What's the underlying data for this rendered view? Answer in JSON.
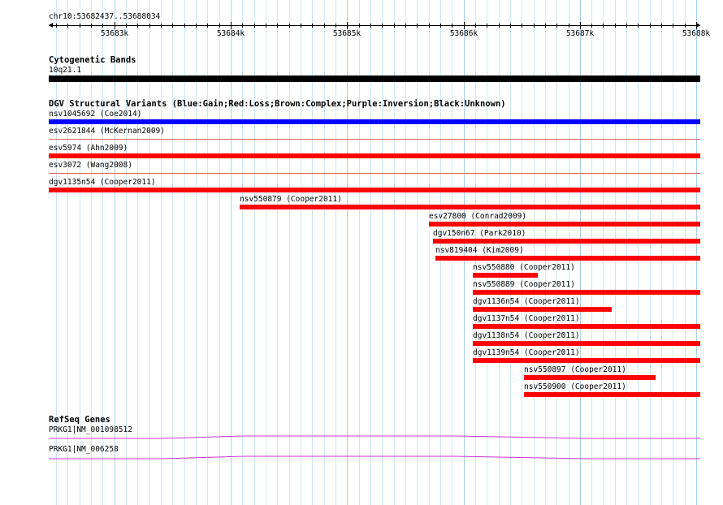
{
  "ruler": {
    "coordinate_label": "chr10:53682437..53688034",
    "ticks": [
      "53683k",
      "53684k",
      "53685k",
      "53686k",
      "53687k",
      "53688k"
    ]
  },
  "cytoband": {
    "title": "Cytogenetic Bands",
    "band_label": "10q21.1",
    "color": "#000000"
  },
  "dgv": {
    "title": "DGV Structural Variants (Blue:Gain;Red:Loss;Brown:Complex;Purple:Inversion;Black:Unknown)",
    "colors": {
      "gain": "#0000ff",
      "loss": "#ff0000",
      "separator": "#e06060"
    },
    "variants": [
      {
        "label": "nsv1045692 (Coe2014)",
        "type": "gain",
        "start": 53682437,
        "end": 53688034
      },
      {
        "label": "esv2621844 (McKernan2009)",
        "type": "loss",
        "start": null,
        "end": null
      },
      {
        "label": "esv5974 (Ahn2009)",
        "type": "loss",
        "start": 53682437,
        "end": 53688034
      },
      {
        "label": "esv3072 (Wang2008)",
        "type": "loss",
        "start": null,
        "end": null
      },
      {
        "label": "dgv1135n54 (Cooper2011)",
        "type": "loss",
        "start": 53682437,
        "end": 53688034
      },
      {
        "label": "nsv550879 (Cooper2011)",
        "type": "loss",
        "start": 53684080,
        "end": 53688034
      },
      {
        "label": "esv27800 (Conrad2009)",
        "type": "loss",
        "start": 53685700,
        "end": 53688034
      },
      {
        "label": "dgv150n67 (Park2010)",
        "type": "loss",
        "start": 53685740,
        "end": 53688034
      },
      {
        "label": "nsv819404 (Kim2009)",
        "type": "loss",
        "start": 53685760,
        "end": 53688034
      },
      {
        "label": "nsv550880 (Cooper2011)",
        "type": "loss",
        "start": 53686080,
        "end": 53686640
      },
      {
        "label": "nsv550889 (Cooper2011)",
        "type": "loss",
        "start": 53686080,
        "end": 53688034
      },
      {
        "label": "dgv1136n54 (Cooper2011)",
        "type": "loss",
        "start": 53686080,
        "end": 53687270
      },
      {
        "label": "dgv1137n54 (Cooper2011)",
        "type": "loss",
        "start": 53686080,
        "end": 53688034
      },
      {
        "label": "dgv1138n54 (Cooper2011)",
        "type": "loss",
        "start": 53686080,
        "end": 53688034
      },
      {
        "label": "dgv1139n54 (Cooper2011)",
        "type": "loss",
        "start": 53686080,
        "end": 53688034
      },
      {
        "label": "nsv550897 (Cooper2011)",
        "type": "loss",
        "start": 53686520,
        "end": 53687650
      },
      {
        "label": "nsv550900 (Cooper2011)",
        "type": "loss",
        "start": 53686520,
        "end": 53688034
      }
    ]
  },
  "refseq": {
    "title": "RefSeq Genes",
    "color": "#cc33cc",
    "genes": [
      {
        "label": "PRKG1|NM_001098512"
      },
      {
        "label": "PRKG1|NM_006258"
      }
    ]
  },
  "grid": {
    "minor_color": "#cce8f4",
    "major_color": "#a8cfe6"
  }
}
